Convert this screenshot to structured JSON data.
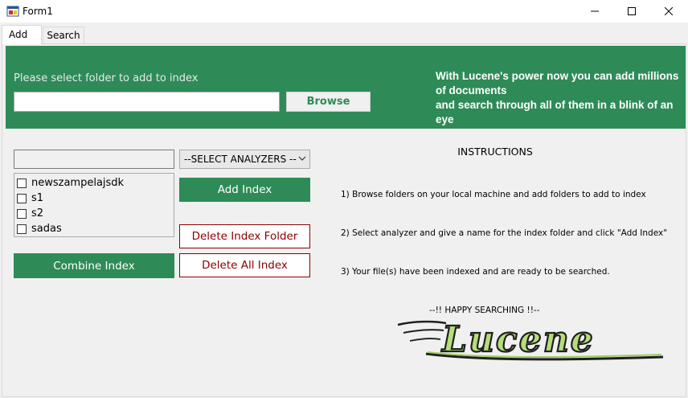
{
  "window": {
    "title": "Form1",
    "controls": {
      "minimize": "—",
      "maximize": "☐",
      "close": "✕"
    }
  },
  "tabs": [
    {
      "label": "Add",
      "selected": true
    },
    {
      "label": "Search",
      "selected": false
    }
  ],
  "banner": {
    "background": "#2e8b57",
    "folder_label": "Please select folder to add to index",
    "folder_value": "",
    "browse_label": "Browse",
    "promo_line1": "With Lucene's power now you can add millions of documents",
    "promo_line2": "and search through all of them in a blink of an eye"
  },
  "index_name_value": "",
  "index_list": [
    {
      "label": "newszampelajsdk",
      "checked": false
    },
    {
      "label": "s1",
      "checked": false
    },
    {
      "label": "s2",
      "checked": false
    },
    {
      "label": "sadas",
      "checked": false
    }
  ],
  "analyzer_select": {
    "selected": "--SELECT ANALYZERS --"
  },
  "buttons": {
    "add_index": "Add Index",
    "delete_index_folder": "Delete Index Folder",
    "delete_all_index": "Delete All Index",
    "combine_index": "Combine Index"
  },
  "instructions": {
    "title": "INSTRUCTIONS",
    "step1": "1) Browse folders on your local machine and add folders to add to index",
    "step2": "2) Select analyzer and give a name for the index folder and click \"Add Index\"",
    "step3": "3) Your file(s) have been indexed and are ready to be searched.",
    "footer": "--!! HAPPY SEARCHING !!--"
  },
  "logo": {
    "text": "Lucene"
  }
}
